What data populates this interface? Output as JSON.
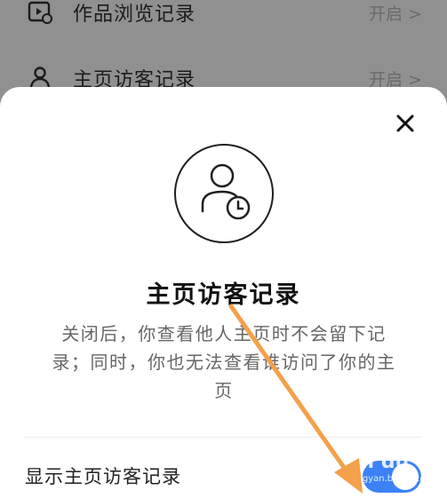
{
  "background_list": {
    "rows": [
      {
        "label": "作品浏览记录",
        "value": "开启",
        "icon": "video-history-icon"
      },
      {
        "label": "主页访客记录",
        "value": "开启",
        "icon": "visitor-icon"
      }
    ],
    "chevron": ">"
  },
  "sheet": {
    "title": "主页访客记录",
    "description": "关闭后，你查看他人主页时不会留下记录；同时，你也无法查看谁访问了你的主页",
    "setting_label": "显示主页访客记录",
    "toggle_on": true,
    "icon": "user-clock-icon"
  },
  "watermark": {
    "brand": "Bai du",
    "sub": "jingyan.baidu.com"
  },
  "colors": {
    "accent": "#3c82f6",
    "annotation_arrow": "#f5a04a"
  }
}
